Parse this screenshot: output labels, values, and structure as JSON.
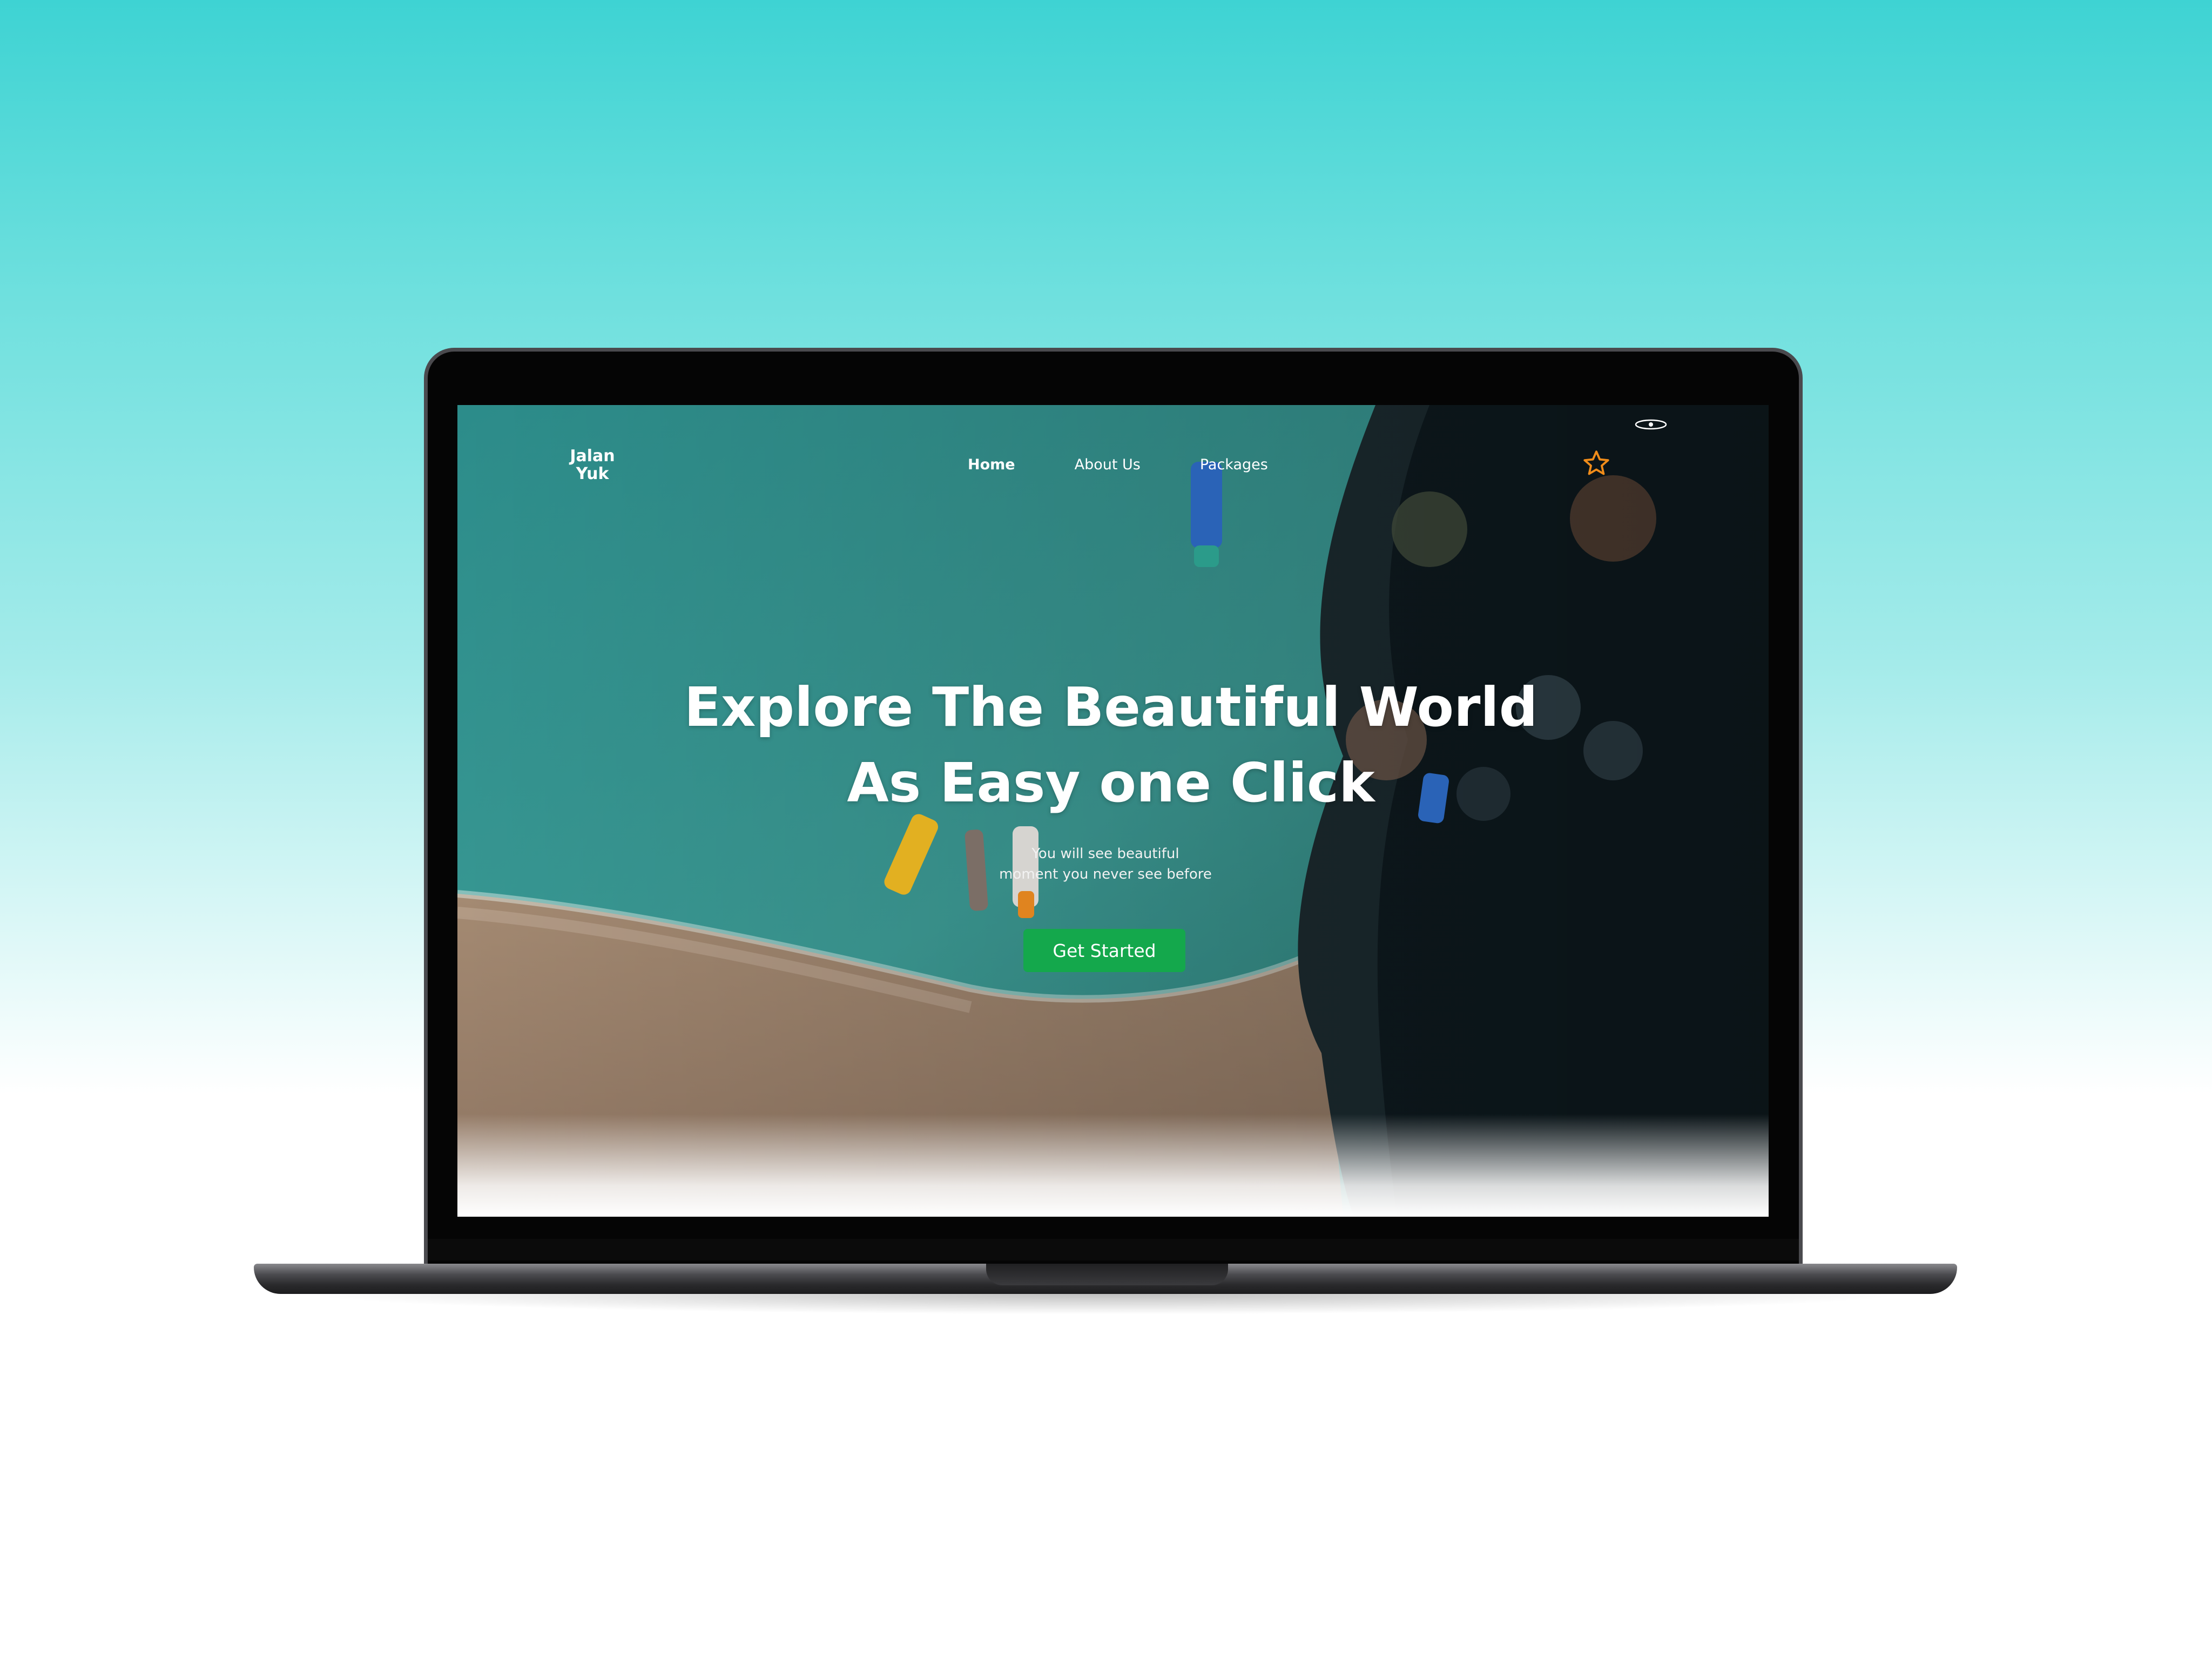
{
  "nav": {
    "logo_line1": "Jalan",
    "logo_line2": "Yuk",
    "links": [
      {
        "label": "Home",
        "active": true
      },
      {
        "label": "About Us",
        "active": false
      },
      {
        "label": "Packages",
        "active": false
      }
    ],
    "icons": [
      "star-icon",
      "eye-icon"
    ]
  },
  "hero": {
    "title_line1": "Explore The Beautiful World",
    "title_line2": "As Easy one Click",
    "subtitle_line1": "You will see beautiful",
    "subtitle_line2": "moment you never see before",
    "cta_label": "Get Started"
  },
  "colors": {
    "accent": "#14a84c",
    "star": "#f08c1a",
    "background_top": "#3ed3d3"
  }
}
